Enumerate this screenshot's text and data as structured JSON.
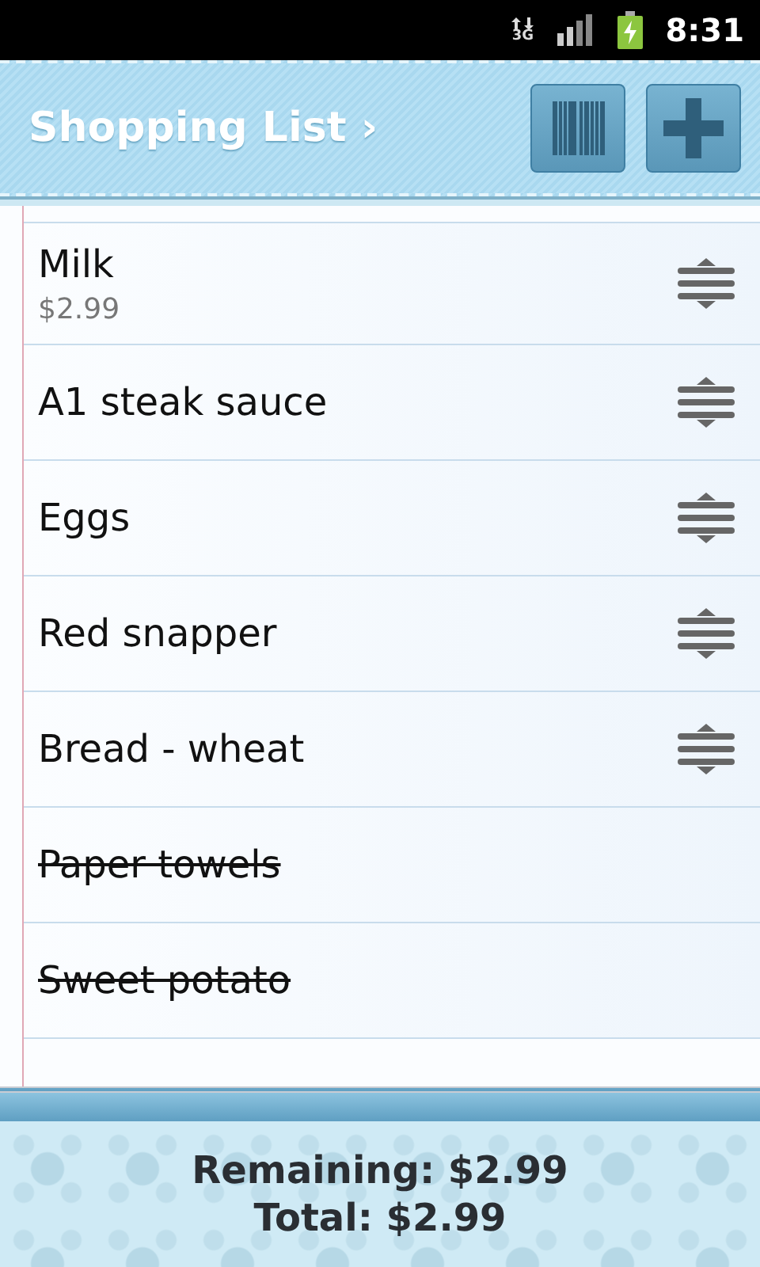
{
  "status_bar": {
    "network": "3G",
    "time": "8:31"
  },
  "header": {
    "title": "Shopping List ›"
  },
  "items": [
    {
      "name": "Milk",
      "price": "$2.99",
      "checked": false
    },
    {
      "name": "A1 steak sauce",
      "checked": false
    },
    {
      "name": "Eggs",
      "checked": false
    },
    {
      "name": "Red snapper",
      "checked": false
    },
    {
      "name": "Bread - wheat",
      "checked": false
    },
    {
      "name": "Paper towels",
      "checked": true
    },
    {
      "name": "Sweet potato",
      "checked": true
    }
  ],
  "footer": {
    "remaining": "Remaining: $2.99",
    "total": "Total: $2.99"
  }
}
